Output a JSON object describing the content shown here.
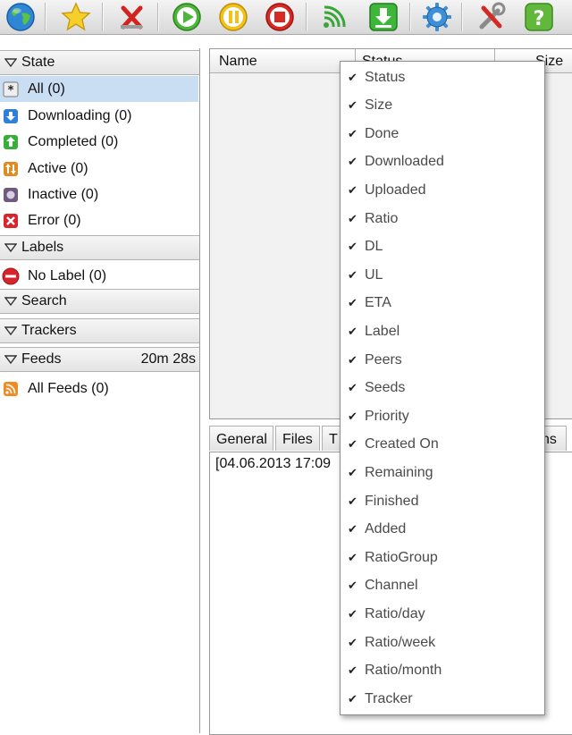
{
  "toolbar": {
    "buttons": [
      {
        "name": "globe-icon"
      },
      {
        "name": "star-icon"
      },
      {
        "name": "remove-icon"
      },
      {
        "name": "play-icon"
      },
      {
        "name": "pause-icon"
      },
      {
        "name": "stop-icon"
      },
      {
        "name": "rss-icon"
      },
      {
        "name": "download-icon"
      },
      {
        "name": "gear-icon"
      },
      {
        "name": "tools-icon"
      },
      {
        "name": "help-icon"
      }
    ]
  },
  "sidebar": {
    "state_header": "State",
    "state_items": [
      {
        "label": "All (0)"
      },
      {
        "label": "Downloading (0)"
      },
      {
        "label": "Completed (0)"
      },
      {
        "label": "Active (0)"
      },
      {
        "label": "Inactive (0)"
      },
      {
        "label": "Error (0)"
      }
    ],
    "labels_header": "Labels",
    "labels_items": [
      {
        "label": "No Label (0)"
      }
    ],
    "search_header": "Search",
    "trackers_header": "Trackers",
    "feeds_header": "Feeds",
    "feeds_time": "20m 28s",
    "feeds_items": [
      {
        "label": "All Feeds (0)"
      }
    ]
  },
  "list": {
    "col_name": "Name",
    "col_status": "Status",
    "col_size": "Size"
  },
  "tabs": {
    "general": "General",
    "files": "Files",
    "trackers_partial": "T",
    "options_partial": "ns"
  },
  "log": {
    "line": "[04.06.2013 17:09"
  },
  "column_menu": {
    "items": [
      "Status",
      "Size",
      "Done",
      "Downloaded",
      "Uploaded",
      "Ratio",
      "DL",
      "UL",
      "ETA",
      "Label",
      "Peers",
      "Seeds",
      "Priority",
      "Created On",
      "Remaining",
      "Finished",
      "Added",
      "RatioGroup",
      "Channel",
      "Ratio/day",
      "Ratio/week",
      "Ratio/month",
      "Tracker"
    ]
  },
  "colors": {
    "selected_row": "#c9ddf3",
    "menu_text": "#4a4a4a"
  }
}
